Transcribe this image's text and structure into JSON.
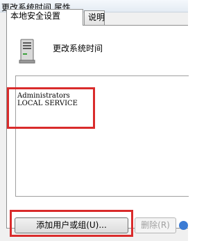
{
  "window": {
    "title": "更改系统时间 属性"
  },
  "tabs": [
    {
      "label": "本地安全设置",
      "active": true
    },
    {
      "label": "说明",
      "active": false
    }
  ],
  "policy": {
    "icon": "server-computer-icon",
    "name": "更改系统时间"
  },
  "members": {
    "items": [
      "Administrators",
      "LOCAL SERVICE"
    ]
  },
  "buttons": {
    "add_label": "添加用户或组(U)...",
    "remove_label": "删除(R)"
  },
  "colors": {
    "highlight": "#d92b2b",
    "panel": "#ffffff",
    "dialog": "#f0f0f0"
  }
}
